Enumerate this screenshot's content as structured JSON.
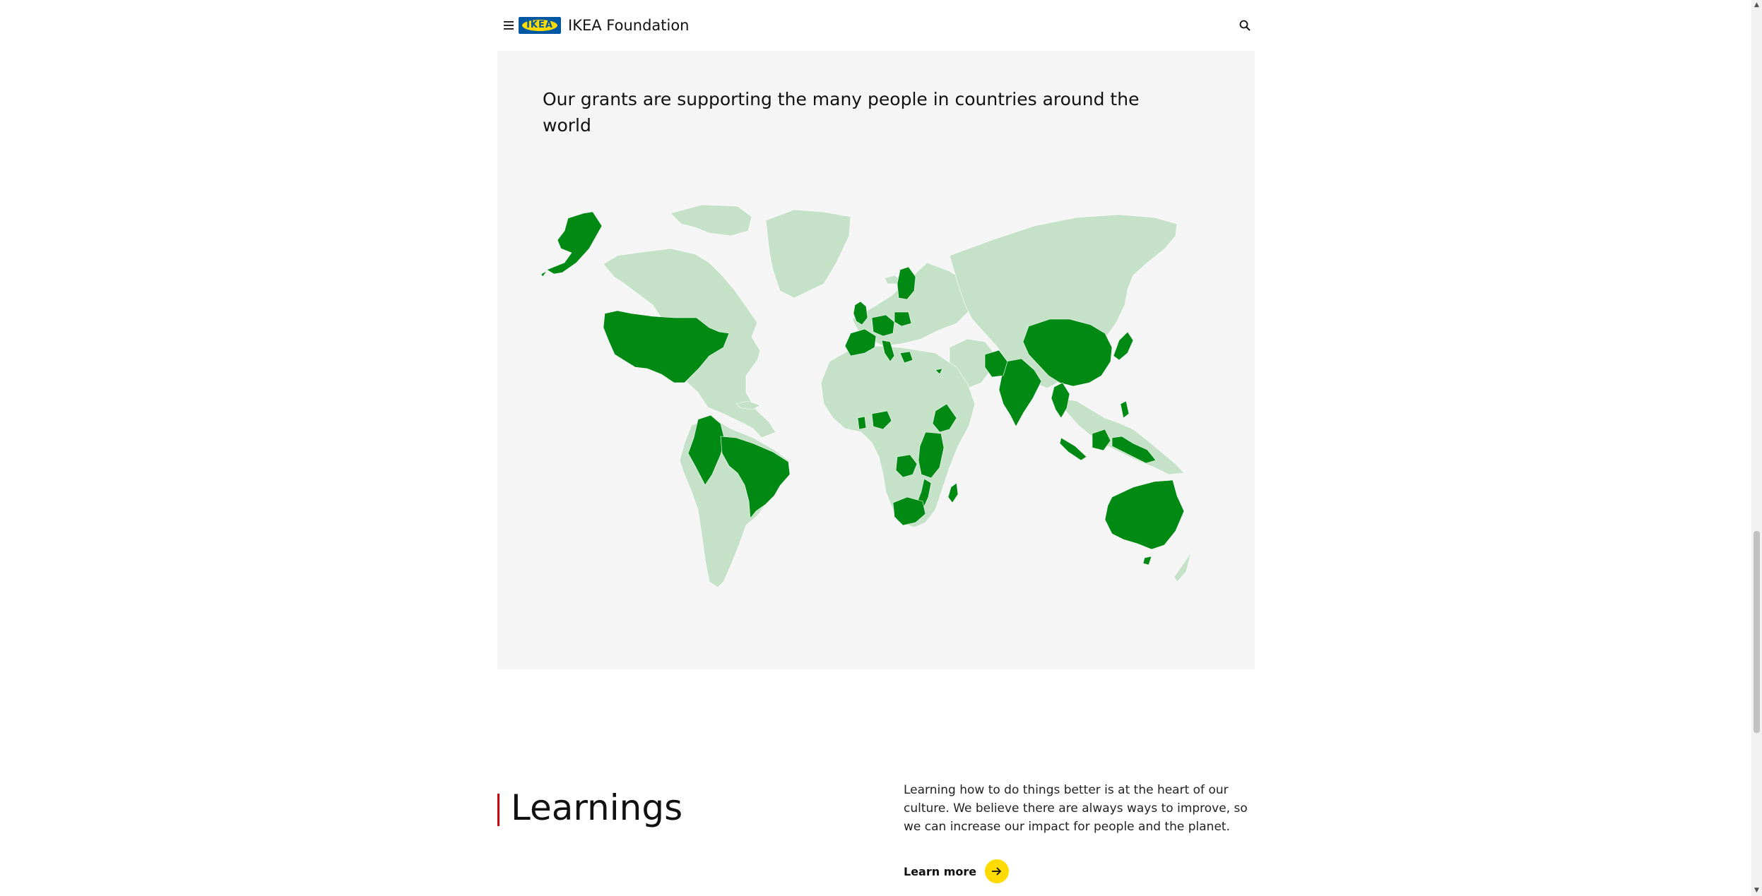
{
  "header": {
    "logo_text": "IKEA",
    "site_name": "IKEA Foundation",
    "menu_icon": "hamburger-icon",
    "search_icon": "search-icon"
  },
  "map_section": {
    "heading": "Our grants are supporting the many people in countries around the world",
    "colors": {
      "panel_background": "#f5f5f5",
      "land_default": "#c5e1c8",
      "land_highlighted": "#008a14"
    },
    "highlighted_regions": [
      "Alaska",
      "United States",
      "Colombia",
      "Ecuador",
      "Peru",
      "Brazil",
      "Finland",
      "United Kingdom",
      "Ireland",
      "Netherlands",
      "Germany",
      "Poland",
      "France",
      "Spain",
      "Portugal",
      "Italy",
      "Greece",
      "Cyprus",
      "Ghana",
      "Nigeria",
      "Ethiopia",
      "Kenya",
      "Uganda",
      "Tanzania",
      "Rwanda",
      "Burundi",
      "Zambia",
      "Malawi",
      "Mozambique",
      "South Africa",
      "Lesotho",
      "Madagascar",
      "Pakistan",
      "Afghanistan",
      "India",
      "Nepal",
      "Bangladesh",
      "Sri Lanka",
      "China",
      "Japan",
      "Myanmar",
      "Thailand",
      "Malaysia",
      "Indonesia",
      "Philippines",
      "Timor-Leste",
      "Papua New Guinea",
      "Australia"
    ]
  },
  "learnings": {
    "title": "Learnings",
    "body": "Learning how to do things better is at the heart of our culture. We believe there are always ways to improve, so we can increase our impact for people and the planet.",
    "link_label": "Learn more",
    "accent_color": "#cc0008",
    "button_color": "#ffdb00"
  }
}
